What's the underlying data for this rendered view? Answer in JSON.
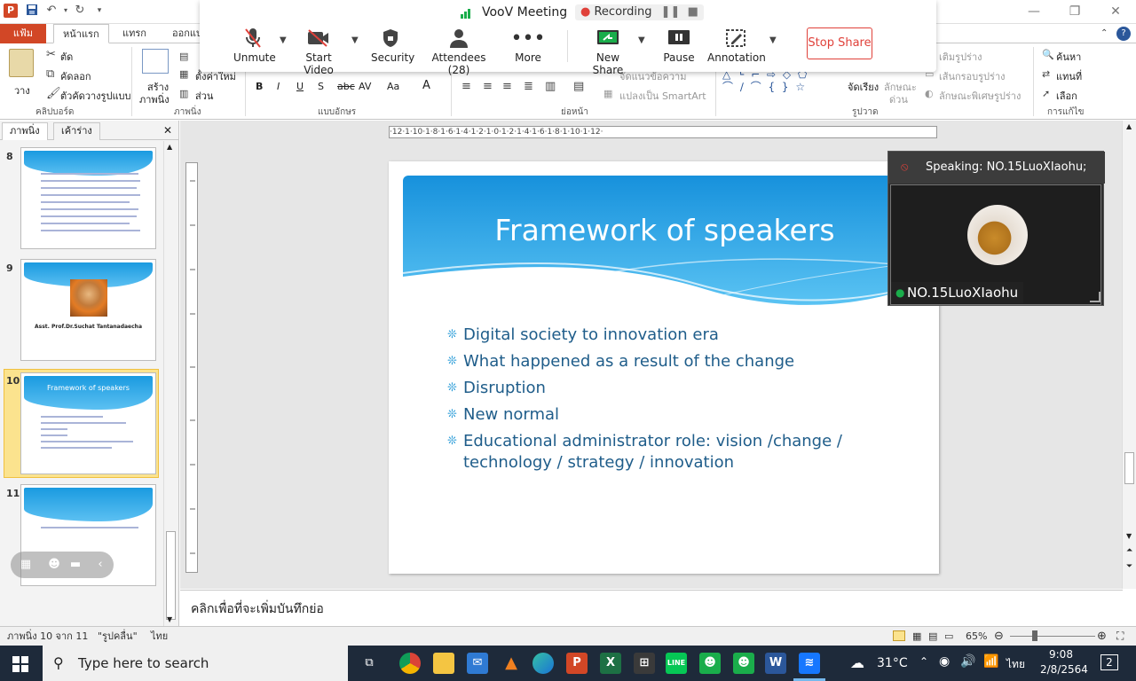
{
  "titlebar": {
    "app_icon": "P",
    "save_icon": "save-icon",
    "undo_icon": "undo-icon",
    "redo_icon": "redo-icon",
    "customize": "▾",
    "minimize": "—",
    "restore": "❐",
    "close": "✕"
  },
  "ribbon_tabs": {
    "file": "แฟ้ม",
    "home": "หน้าแรก",
    "insert": "แทรก",
    "design": "ออกแบ"
  },
  "ribbon": {
    "paste": "วาง",
    "cut": "ตัด",
    "copy": "คัดลอก",
    "format_painter": "ตัวคัดวางรูปแบบ",
    "clipboard_group": "คลิปบอร์ด",
    "new_slide_line1": "สร้าง",
    "new_slide_line2": "ภาพนิ่ง",
    "reset": "ตั้งค่าใหม่",
    "section": "ส่วน",
    "slides_group": "ภาพนิ่ง",
    "font_group": "แบบอักษร",
    "paragraph_group": "ย่อหน้า",
    "align_text": "จัดแนวข้อความ",
    "convert_smartart": "แปลงเป็น SmartArt",
    "arrange": "จัดเรียง",
    "quick_styles_line1": "ลักษณะ",
    "quick_styles_line2": "ด่วน",
    "shape_fill": "เติมรูปร่าง",
    "shape_outline": "เส้นกรอบรูปร่าง",
    "shape_effects": "ลักษณะพิเศษรูปร่าง",
    "drawing_group": "รูปวาด",
    "find": "ค้นหา",
    "replace": "แทนที่",
    "select": "เลือก",
    "editing_group": "การแก้ไข"
  },
  "voov": {
    "title": "VooV Meeting",
    "recording": "Recording",
    "buttons": {
      "unmute": "Unmute",
      "start_video": "Start Video",
      "security": "Security",
      "attendees": "Attendees (28)",
      "more": "More",
      "new_share": "New Share",
      "pause": "Pause",
      "annotation": "Annotation"
    },
    "stop_share": "Stop Share"
  },
  "left_panel": {
    "tab_slides": "ภาพนิ่ง",
    "tab_outline": "เค้าร่าง",
    "close": "✕",
    "slides": [
      {
        "num": "8",
        "title": ""
      },
      {
        "num": "9",
        "title": "Asst. Prof.Dr.Suchat Tantanadaecha"
      },
      {
        "num": "10",
        "title": "Framework of speakers"
      },
      {
        "num": "11",
        "title": ""
      }
    ]
  },
  "ruler": {
    "h_ticks": "·12·1·10·1·8·1·6·1·4·1·2·1·0·1·2·1·4·1·6·1·8·1·10·1·12·"
  },
  "slide": {
    "title": "Framework of speakers",
    "bullets": [
      "Digital society to innovation era",
      "What happened as a result of the change",
      "Disruption",
      "New normal",
      "Educational administrator role: vision /change / technology / strategy / innovation"
    ]
  },
  "video": {
    "speaking": "Speaking: NO.15LuoXIaohu;",
    "name": "NO.15LuoXIaohu"
  },
  "notes": {
    "placeholder": "คลิกเพื่อที่จะเพิ่มบันทึกย่อ"
  },
  "status": {
    "slide_info": "ภาพนิ่ง 10 จาก 11",
    "theme": "\"รูปคลื่น\"",
    "language": "ไทย",
    "zoom": "65%"
  },
  "taskbar": {
    "search_placeholder": "Type here to search",
    "temperature": "31°C",
    "language": "ไทย",
    "time": "9:08",
    "date": "2/8/2564",
    "notifications": "2"
  },
  "colors": {
    "file_tab": "#d24726",
    "slide_blue": "#1a9ae0",
    "bullet_text": "#1f5d8a",
    "stop_share": "#e0413a"
  }
}
